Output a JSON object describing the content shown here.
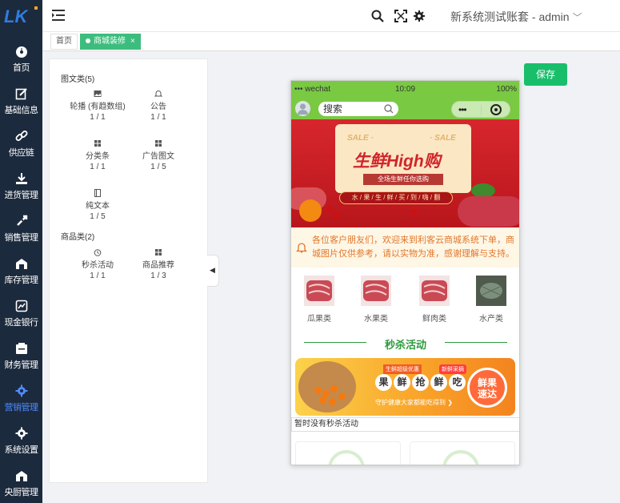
{
  "sidebar": {
    "logo": "LK",
    "items": [
      {
        "label": "首页",
        "icon": "dashboard-icon"
      },
      {
        "label": "基础信息",
        "icon": "edit-icon"
      },
      {
        "label": "供应链",
        "icon": "link-icon"
      },
      {
        "label": "进货管理",
        "icon": "download-icon"
      },
      {
        "label": "销售管理",
        "icon": "rocket-icon"
      },
      {
        "label": "库存管理",
        "icon": "warehouse-icon"
      },
      {
        "label": "现金银行",
        "icon": "chart-box-icon"
      },
      {
        "label": "财务管理",
        "icon": "finance-icon"
      },
      {
        "label": "营销管理",
        "icon": "gear-icon",
        "active": true
      },
      {
        "label": "系统设置",
        "icon": "settings-icon"
      },
      {
        "label": "央厨管理",
        "icon": "kitchen-icon"
      }
    ]
  },
  "header": {
    "account": "新系统测试账套 - admin"
  },
  "tabs": [
    {
      "label": "首页"
    },
    {
      "label": "商城装修",
      "close": "×",
      "active": true
    }
  ],
  "components": {
    "group1_title": "图文类(5)",
    "group1": [
      {
        "name": "轮播 (有趋数组)",
        "count": "1 / 1",
        "icon": "image-icon"
      },
      {
        "name": "公告",
        "count": "1 / 1",
        "icon": "bell-icon"
      },
      {
        "name": "分类条",
        "count": "1 / 1",
        "icon": "grid-icon"
      },
      {
        "name": "广告图文",
        "count": "1 / 5",
        "icon": "grid-icon"
      },
      {
        "name": "纯文本",
        "count": "1 / 5",
        "icon": "text-icon"
      }
    ],
    "group2_title": "商品类(2)",
    "group2": [
      {
        "name": "秒杀活动",
        "count": "1 / 1",
        "icon": "clock-icon"
      },
      {
        "name": "商品推荐",
        "count": "1 / 3",
        "icon": "grid-icon"
      }
    ]
  },
  "save_label": "保存",
  "phone": {
    "signal": "••• wechat",
    "time": "10:09",
    "battery": "100%",
    "search_placeholder": "搜索",
    "capsule_more": "•••",
    "banner": {
      "sale_left": "SALE ·",
      "sale_right": "· SALE",
      "headline": "生鲜High购",
      "subline": "全场生鲜任你选购",
      "ribbon": "水 / 果 / 生 / 鲜 / 买 / 到 / 嗨 / 翻"
    },
    "notice": "各位客户朋友们，欢迎来到利客云商城系统下单，商城图片仅供参考，请以实物为准，感谢理解与支持。",
    "categories": [
      {
        "label": "瓜果类"
      },
      {
        "label": "水果类"
      },
      {
        "label": "鲜肉类"
      },
      {
        "label": "水产类"
      }
    ],
    "seckill_title": "秒杀活动",
    "promo": {
      "tag": "生鲜超级优惠",
      "tag2": "新鲜采摘",
      "chars": [
        "果",
        "鲜",
        "抢",
        "鲜",
        "吃"
      ],
      "slogan": "守护健康大家都能吃得到 ❯",
      "badge_line1": "鲜果",
      "badge_line2": "速达"
    },
    "empty_text": "暂时没有秒杀活动"
  },
  "colors": {
    "sidebar_bg": "#1c2a3d",
    "active_nav": "#4e8cff",
    "accent_green": "#19be6b",
    "wechat_green": "#7ac943",
    "banner_red": "#d7262d",
    "notice_orange": "#e1772b"
  }
}
